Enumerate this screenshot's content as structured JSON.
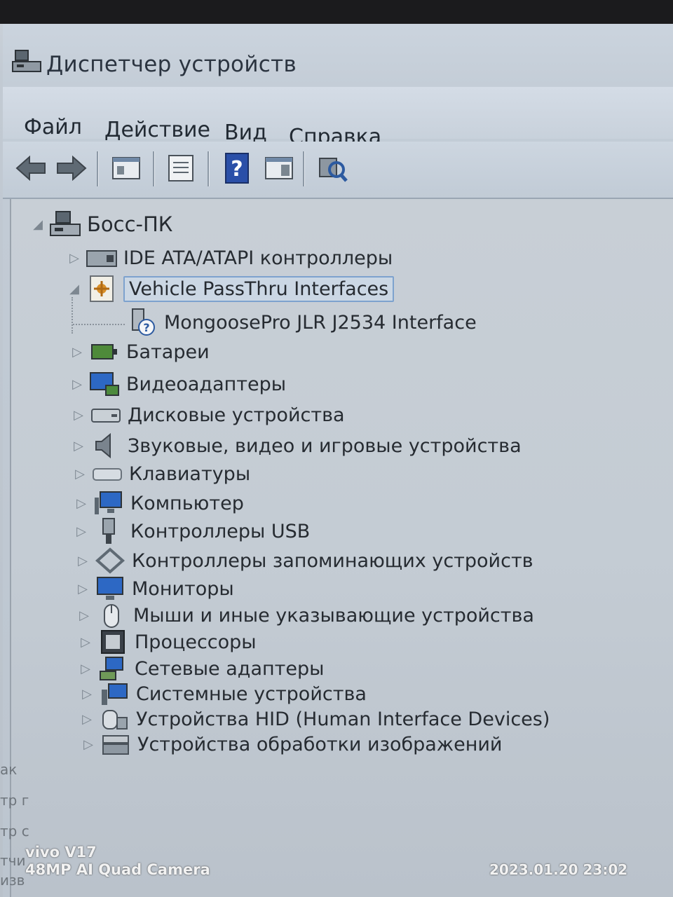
{
  "window": {
    "title": "Диспетчер устройств"
  },
  "menu": {
    "file": "Файл",
    "action": "Действие",
    "view": "Вид",
    "help": "Справка"
  },
  "toolbar": {
    "buttons": [
      "back-arrow-icon",
      "forward-arrow-icon",
      "show-hide-console-tree-icon",
      "properties-icon",
      "help-icon",
      "action-pane-icon",
      "scan-hardware-icon"
    ]
  },
  "tree": {
    "root": "Босс-ПК",
    "items": [
      {
        "label": "IDE ATA/ATAPI контроллеры",
        "icon": "ide-controller-icon"
      },
      {
        "label": "Vehicle PassThru Interfaces",
        "icon": "passthru-interface-icon",
        "expanded": true,
        "selected": true,
        "children": [
          {
            "label": "MongoosePro JLR J2534 Interface",
            "icon": "unknown-device-icon"
          }
        ]
      },
      {
        "label": "Батареи",
        "icon": "battery-icon"
      },
      {
        "label": "Видеоадаптеры",
        "icon": "display-adapter-icon"
      },
      {
        "label": "Дисковые устройства",
        "icon": "disk-drive-icon"
      },
      {
        "label": "Звуковые, видео и игровые устройства",
        "icon": "sound-icon"
      },
      {
        "label": "Клавиатуры",
        "icon": "keyboard-icon"
      },
      {
        "label": "Компьютер",
        "icon": "computer-icon"
      },
      {
        "label": "Контроллеры USB",
        "icon": "usb-icon"
      },
      {
        "label": "Контроллеры запоминающих устройств",
        "icon": "storage-controller-icon"
      },
      {
        "label": "Мониторы",
        "icon": "monitor-icon"
      },
      {
        "label": "Мыши и иные указывающие устройства",
        "icon": "mouse-icon"
      },
      {
        "label": "Процессоры",
        "icon": "processor-icon"
      },
      {
        "label": "Сетевые адаптеры",
        "icon": "network-adapter-icon"
      },
      {
        "label": "Системные устройства",
        "icon": "system-device-icon"
      },
      {
        "label": "Устройства HID (Human Interface Devices)",
        "icon": "hid-icon"
      },
      {
        "label": "Устройства обработки изображений",
        "icon": "imaging-device-icon"
      }
    ]
  },
  "edge_fragments": [
    "ак",
    "тр г",
    "тр с",
    "тчи",
    "изв"
  ],
  "camera_overlay": {
    "model": "vivo V17",
    "camera": "48MP AI Quad Camera",
    "timestamp": "2023.01.20 23:02"
  },
  "colors": {
    "selection_border": "#7da2ce",
    "text": "#262b31",
    "window_bg": "#c4ccd4"
  }
}
